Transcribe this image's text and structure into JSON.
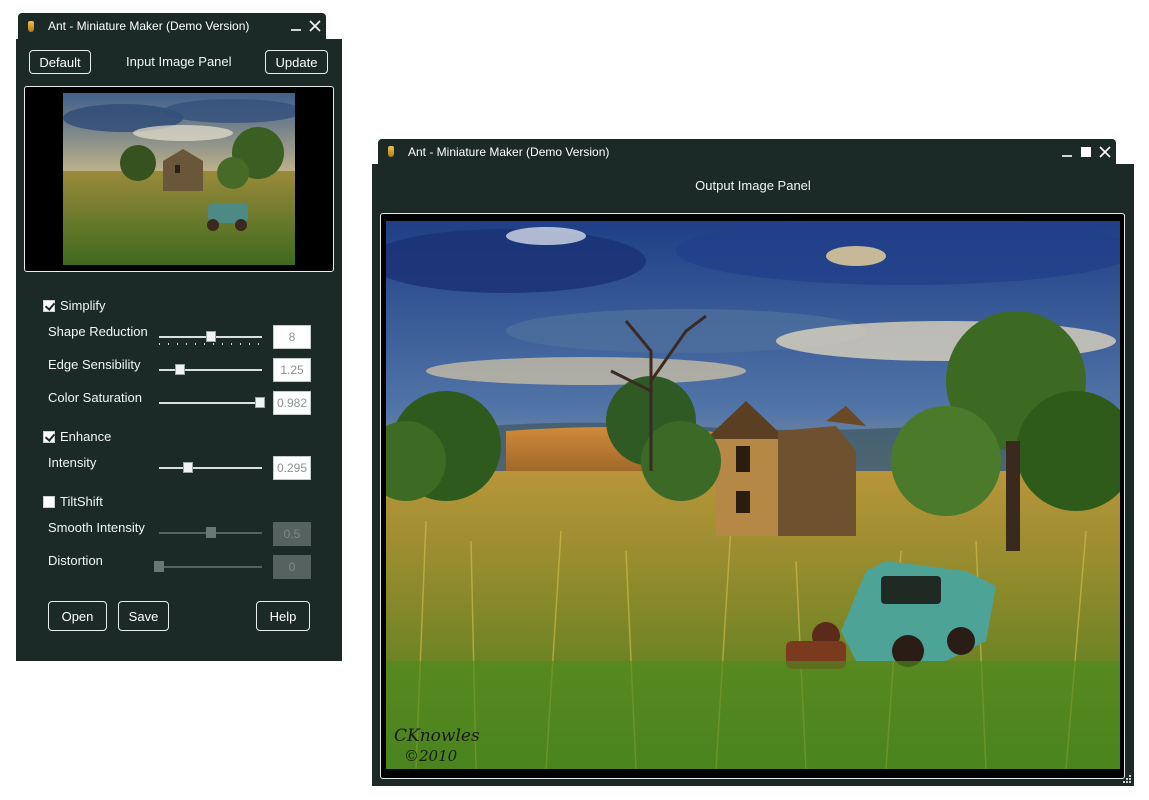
{
  "input_window": {
    "title": "Ant - Miniature Maker (Demo Version)",
    "default_label": "Default",
    "panel_title": "Input Image Panel",
    "update_label": "Update",
    "controls": {
      "simplify": {
        "label": "Simplify",
        "checked": true
      },
      "shape_reduction": {
        "label": "Shape Reduction",
        "value": "8",
        "position": 0.5
      },
      "edge_sensibility": {
        "label": "Edge Sensibility",
        "value": "1.25",
        "position": 0.2
      },
      "color_saturation": {
        "label": "Color Saturation",
        "value": "0.982",
        "position": 0.98
      },
      "enhance": {
        "label": "Enhance",
        "checked": true
      },
      "intensity": {
        "label": "Intensity",
        "value": "0.295",
        "position": 0.28
      },
      "tiltshift": {
        "label": "TiltShift",
        "checked": false
      },
      "smooth_intensity": {
        "label": "Smooth Intensity",
        "value": "0.5",
        "position": 0.5
      },
      "distortion": {
        "label": "Distortion",
        "value": "0",
        "position": 0.0
      }
    },
    "open_label": "Open",
    "save_label": "Save",
    "help_label": "Help"
  },
  "output_window": {
    "title": "Ant - Miniature Maker (Demo Version)",
    "panel_title": "Output Image Panel"
  },
  "image": {
    "watermark_name": "CKnowles",
    "watermark_year": "©2010"
  },
  "icons": {
    "app": "ant-icon",
    "minimize": "minimize-icon",
    "maximize": "maximize-icon",
    "close": "close-icon"
  }
}
